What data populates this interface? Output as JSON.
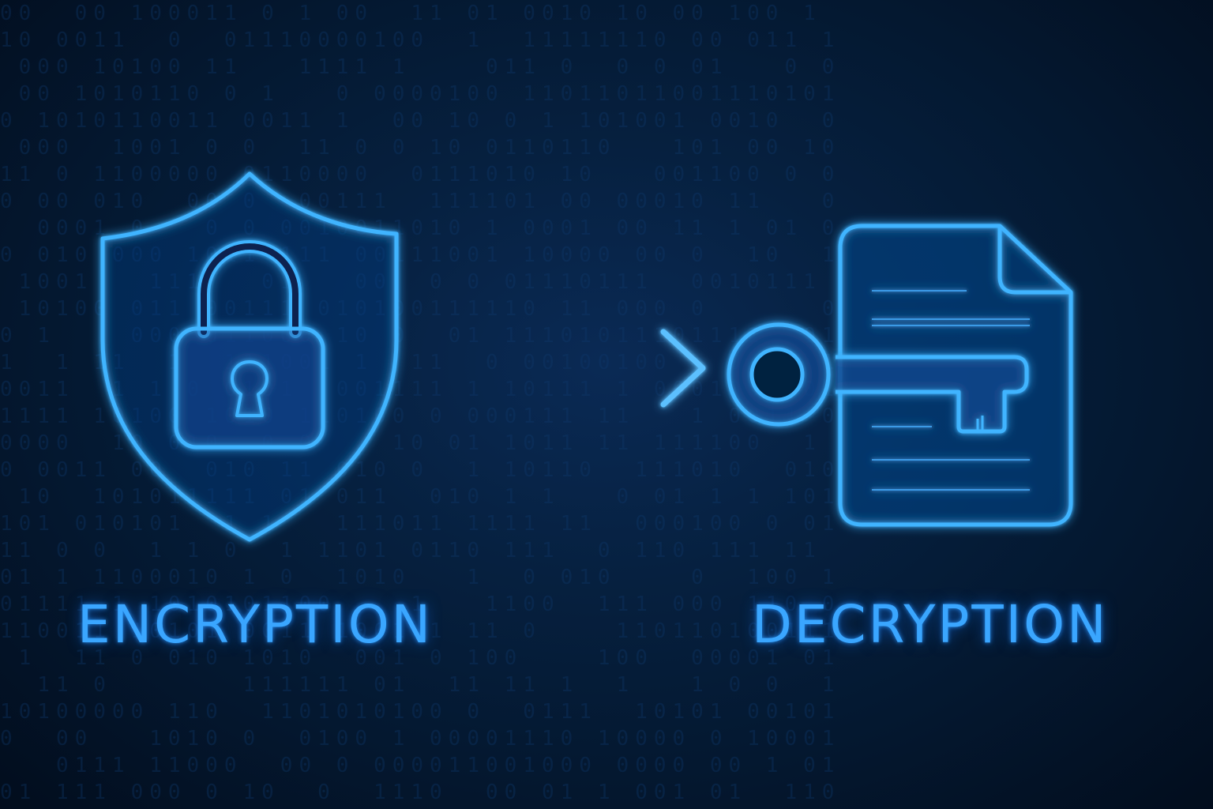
{
  "labels": {
    "left": "ENCRYPTION",
    "right": "DECRYPTION"
  },
  "icons": {
    "left": [
      "shield-icon",
      "padlock-icon"
    ],
    "center": "arrow-right-icon",
    "right": [
      "document-icon",
      "key-icon"
    ]
  },
  "colors": {
    "background": "#031428",
    "glow": "#3aa6ff",
    "stroke": "#40b4ff"
  }
}
